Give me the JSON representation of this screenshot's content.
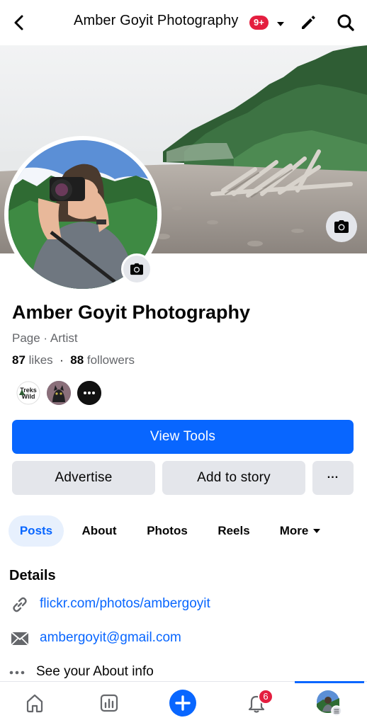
{
  "header": {
    "title": "Amber Goyit Photography",
    "badge": "9+",
    "icons": [
      "back-arrow-icon",
      "caret-down-icon",
      "pencil-icon",
      "search-icon"
    ]
  },
  "page": {
    "name": "Amber Goyit Photography",
    "category": "Page · Artist",
    "likes_count": "87",
    "likes_label": "likes",
    "separator": "·",
    "followers_count": "88",
    "followers_label": "followers",
    "mini_avatar_1_label": "Treks Wild"
  },
  "buttons": {
    "view_tools": "View Tools",
    "advertise": "Advertise",
    "add_to_story": "Add to story",
    "more": "···"
  },
  "tabs": [
    {
      "label": "Posts",
      "active": true
    },
    {
      "label": "About",
      "active": false
    },
    {
      "label": "Photos",
      "active": false
    },
    {
      "label": "Reels",
      "active": false
    },
    {
      "label": "More",
      "active": false
    }
  ],
  "details": {
    "title": "Details",
    "website": "flickr.com/photos/ambergoyit",
    "email": "ambergoyit@gmail.com",
    "about": "See your About info"
  },
  "bottom_nav": {
    "notifications_badge": "6",
    "items": [
      "home-icon",
      "insights-icon",
      "create-icon",
      "notifications-icon",
      "profile-icon"
    ]
  },
  "colors": {
    "accent": "#0866ff",
    "badge": "#e41e3f",
    "button_gray": "#e4e6eb",
    "secondary_text": "#65676b"
  }
}
